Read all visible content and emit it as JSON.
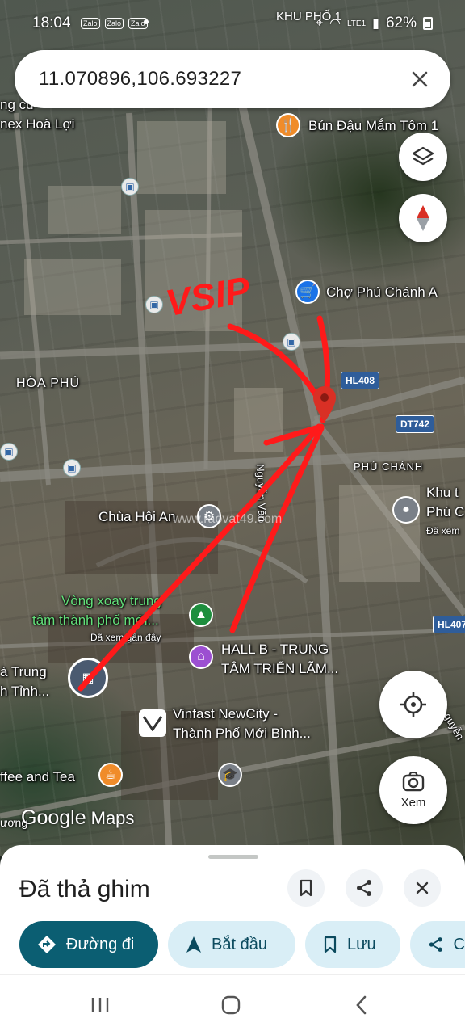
{
  "status_bar": {
    "time": "18:04",
    "app_icons": [
      "Zalo",
      "Zalo",
      "Zalo"
    ],
    "network": "LTE1",
    "battery": "62%",
    "location_name": "KHU PHỐ 1"
  },
  "search": {
    "query": "11.070896,106.693227"
  },
  "map": {
    "labels": {
      "hoa_phu": "HÒA PHÚ",
      "phu_chanh": "PHÚ CHÁNH",
      "ng_cu": "ng cư",
      "becamex": "nex Hoà Lợi",
      "bun_dau": "Bún Đậu Mắm Tôm 1",
      "cho_phu_chanh": "Chợ Phú Chánh A",
      "chua_hoi_an": "Chùa Hội An",
      "vong_xoay_1": "Vòng xoay trung",
      "vong_xoay_2": "tâm thành phố mới...",
      "vong_xoay_sub": "Đã xem gần đây",
      "hall_b_1": "HALL B - TRUNG",
      "hall_b_2": "TÂM TRIỂN LÃM...",
      "vinfast_1": "Vinfast NewCity -",
      "vinfast_2": "Thành Phố Mới Bình...",
      "ha_trung_1": "à Trung",
      "ha_trung_2": "h Tỉnh...",
      "khu_1": "Khu t",
      "khu_2": "Phú C",
      "khu_sub": "Đã xem",
      "coffee": "ffee and Tea",
      "uong": "ương",
      "nguyen_van": "Nguyễn Văn",
      "nguyen_right": "guyễn",
      "vsip": "VSIP",
      "watermark": "www.raovat49.com"
    },
    "road_badges": {
      "hl408": "HL408",
      "dt742": "DT742",
      "hl407": "HL407"
    },
    "google_logo": "Google",
    "maps_word": "Maps"
  },
  "fabs": {
    "xem_label": "Xem"
  },
  "sheet": {
    "title": "Đã thả ghim",
    "chips": {
      "directions": "Đường đi",
      "start": "Bắt đầu",
      "save": "Lưu",
      "share": "C"
    }
  },
  "colors": {
    "primary_chip": "#0b5e72",
    "secondary_chip": "#d9eef6",
    "annotation_red": "#ff1a1a"
  }
}
